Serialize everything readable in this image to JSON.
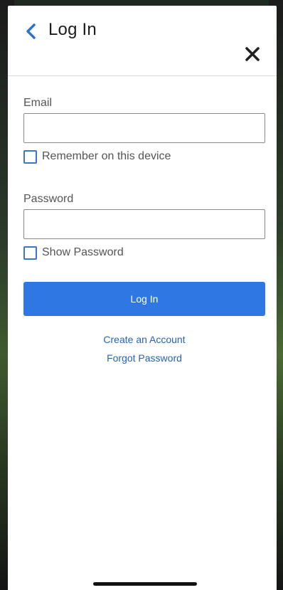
{
  "header": {
    "title": "Log In",
    "back_icon": "chevron-left-icon",
    "close_icon": "close-icon"
  },
  "form": {
    "email_label": "Email",
    "email_value": "",
    "remember_label": "Remember on this device",
    "remember_checked": false,
    "password_label": "Password",
    "password_value": "",
    "show_password_label": "Show Password",
    "show_password_checked": false,
    "submit_label": "Log In"
  },
  "links": {
    "create_account": "Create an Account",
    "forgot_password": "Forgot Password"
  },
  "colors": {
    "accent": "#2f78e3",
    "link": "#2563b8",
    "checkbox_border": "#3a73d6"
  }
}
